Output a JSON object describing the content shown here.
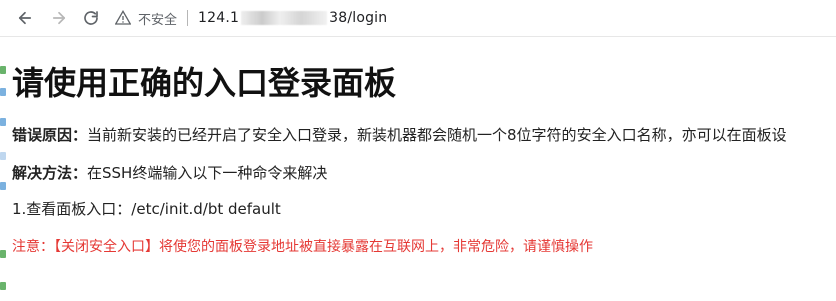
{
  "browser": {
    "insecure_text": "不安全",
    "url_prefix": "124.1",
    "url_suffix": "38/login"
  },
  "page": {
    "title": "请使用正确的入口登录面板",
    "error_reason": {
      "label": "错误原因：",
      "text": "当前新安装的已经开启了安全入口登录，新装机器都会随机一个8位字符的安全入口名称，亦可以在面板设"
    },
    "solution": {
      "label": "解决方法：",
      "text": "在SSH终端输入以下一种命令来解决"
    },
    "step1": "1.查看面板入口：/etc/init.d/bt default",
    "notice": "注意：【关闭安全入口】将使您的面板登录地址被直接暴露在互联网上，非常危险，请谨慎操作"
  },
  "colors": {
    "notice": "#e53935",
    "title": "#111111",
    "text": "#222222"
  }
}
